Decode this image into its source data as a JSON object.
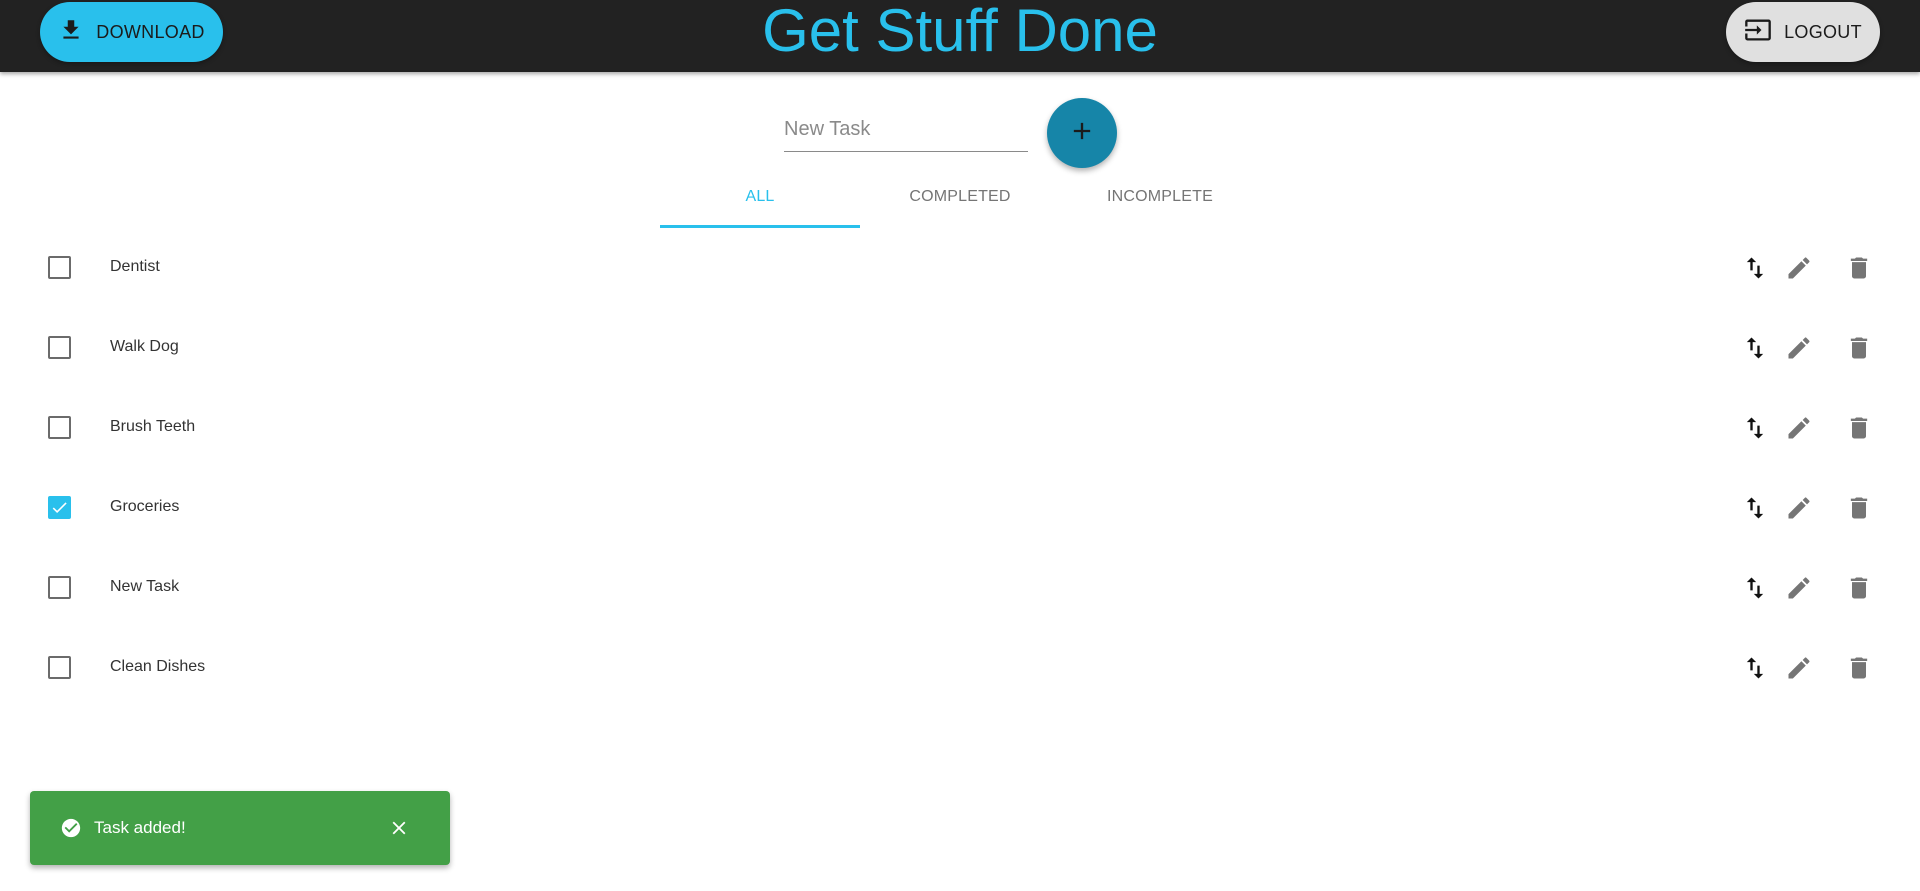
{
  "header": {
    "download_label": "DOWNLOAD",
    "title": "Get Stuff Done",
    "logout_label": "LOGOUT"
  },
  "new_task": {
    "placeholder": "New Task",
    "value": ""
  },
  "tabs": [
    {
      "label": "ALL",
      "active": true
    },
    {
      "label": "COMPLETED",
      "active": false
    },
    {
      "label": "INCOMPLETE",
      "active": false
    }
  ],
  "tasks": [
    {
      "label": "Dentist",
      "checked": false
    },
    {
      "label": "Walk Dog",
      "checked": false
    },
    {
      "label": "Brush Teeth",
      "checked": false
    },
    {
      "label": "Groceries",
      "checked": true
    },
    {
      "label": "New Task",
      "checked": false
    },
    {
      "label": "Clean Dishes",
      "checked": false
    }
  ],
  "snackbar": {
    "message": "Task added!"
  },
  "colors": {
    "accent": "#29c0ec",
    "header_bg": "#222222",
    "add_button": "#1685a8",
    "success": "#43a047"
  },
  "icons": {
    "download": "download-icon",
    "logout": "logout-icon",
    "add": "plus-icon",
    "reorder": "swap-vertical-icon",
    "edit": "pencil-icon",
    "delete": "trash-icon",
    "success": "check-circle-icon",
    "close": "close-icon"
  }
}
